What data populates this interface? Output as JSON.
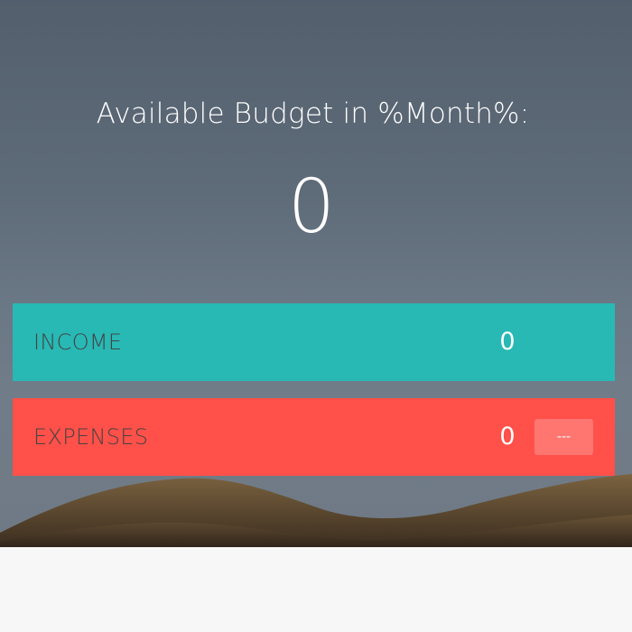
{
  "budget": {
    "title": "Available Budget in %Month%:",
    "value": "0"
  },
  "income": {
    "label": "INCOME",
    "value": "0"
  },
  "expenses": {
    "label": "EXPENSES",
    "value": "0",
    "percentage": "---"
  },
  "colors": {
    "income": "#28b9b5",
    "expenses": "#ff5049",
    "header_background": "#5e6b79"
  }
}
